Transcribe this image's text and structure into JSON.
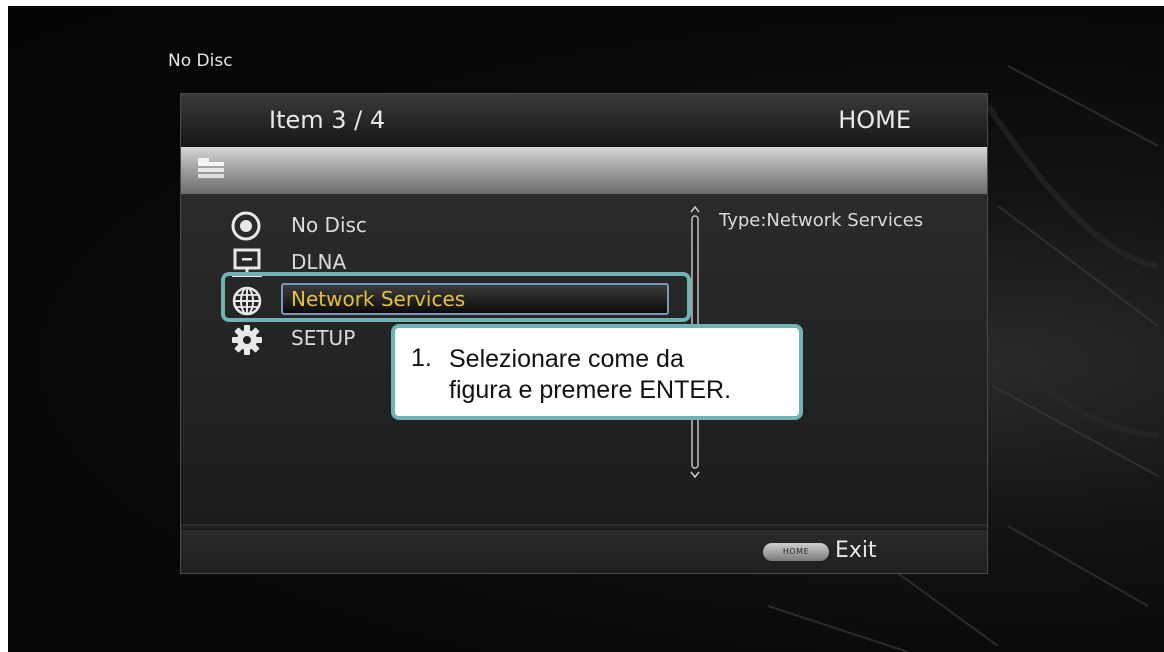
{
  "status": {
    "disc_status": "No Disc"
  },
  "header": {
    "item_count": "Item 3 / 4",
    "title": "HOME"
  },
  "menu": {
    "items": [
      {
        "label": "No Disc",
        "icon": "disc-icon"
      },
      {
        "label": "DLNA",
        "icon": "network-monitor-icon"
      },
      {
        "label": "Network Services",
        "icon": "globe-icon",
        "selected": true
      },
      {
        "label": "SETUP",
        "icon": "gear-icon"
      }
    ]
  },
  "info": {
    "type_text": "Type:Network Services"
  },
  "footer": {
    "home_button": "HOME",
    "exit_label": "Exit"
  },
  "callout": {
    "number": "1.",
    "line1": "Selezionare come da",
    "line2": "figura e premere ENTER."
  },
  "colors": {
    "accent_teal": "#6fb3b5",
    "selected_text": "#e3c23a",
    "selection_border": "#7d96c0"
  }
}
